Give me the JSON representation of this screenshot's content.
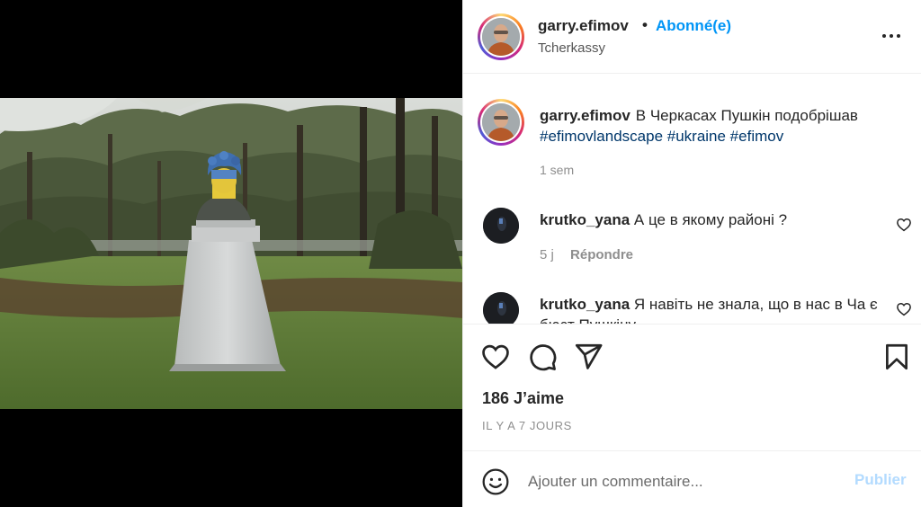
{
  "post": {
    "author": "garry.efimov",
    "separator": "•",
    "follow_label": "Abonné(e)",
    "location": "Tcherkassy",
    "more_icon": "more-horizontal-icon"
  },
  "caption": {
    "author": "garry.efimov",
    "text": "В Черкасах Пушкін подобрішав",
    "hashtags": "#efimovlandscape #ukraine #efimov",
    "time": "1 sem"
  },
  "comments": [
    {
      "author": "krutko_yana",
      "text": "А це в якому районі ?",
      "time": "5 j",
      "reply_label": "Répondre"
    },
    {
      "author": "krutko_yana",
      "text": "Я навіть не знала, що в нас в Ча є бюст Пушкіну"
    }
  ],
  "actions": {
    "icons": [
      "heart-icon",
      "comment-icon",
      "share-icon",
      "bookmark-icon"
    ],
    "likes": "186 J’aime",
    "timestamp": "IL Y A 7 JOURS"
  },
  "add_comment": {
    "placeholder": "Ajouter un commentaire...",
    "publish_label": "Publier"
  },
  "colors": {
    "accent": "#0095f6",
    "publish_disabled": "#b3dbff",
    "text": "#262626",
    "muted": "#8e8e8e"
  }
}
